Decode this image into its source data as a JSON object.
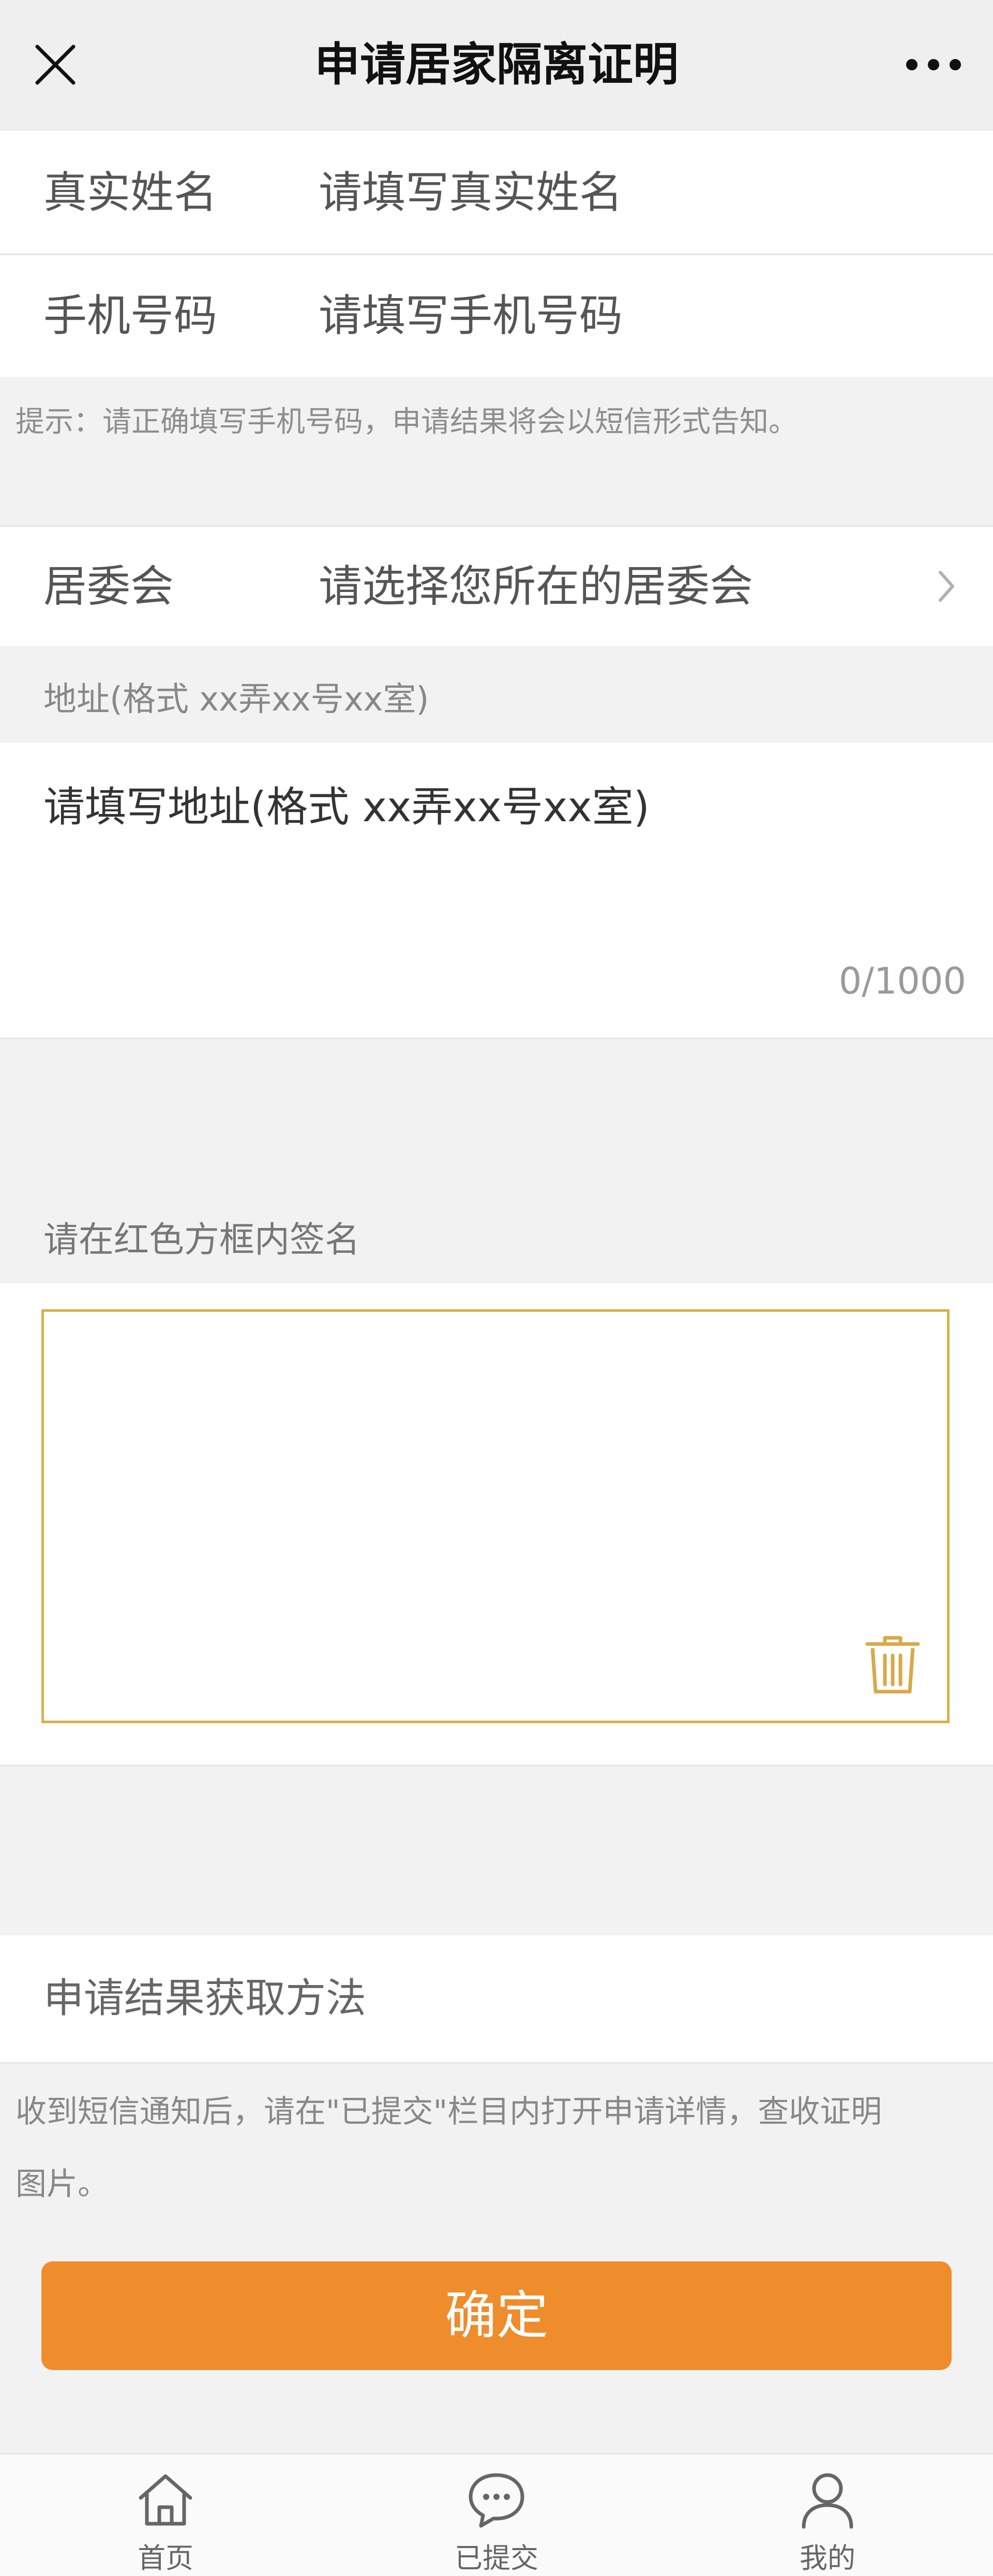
{
  "header": {
    "title": "申请居家隔离证明"
  },
  "form": {
    "name": {
      "label": "真实姓名",
      "placeholder": "请填写真实姓名"
    },
    "phone": {
      "label": "手机号码",
      "placeholder": "请填写手机号码"
    },
    "hint": "提示：请正确填写手机号码，申请结果将会以短信形式告知。",
    "committee": {
      "label": "居委会",
      "placeholder": "请选择您所在的居委会"
    },
    "address": {
      "label": "地址(格式 xx弄xx号xx室)",
      "placeholder": "请填写地址(格式  xx弄xx号xx室)",
      "counter": "0/1000"
    },
    "signature": {
      "label": "请在红色方框内签名"
    },
    "result_method": {
      "label": "申请结果获取方法",
      "description_line1": "收到短信通知后，请在\"已提交\"栏目内打开申请详情，查收证明",
      "description_line2": "图片。"
    },
    "confirm_label": "确定"
  },
  "tabbar": {
    "items": [
      {
        "label": "首页",
        "icon": "home-icon"
      },
      {
        "label": "已提交",
        "icon": "chat-bubble-icon"
      },
      {
        "label": "我的",
        "icon": "user-icon"
      }
    ]
  },
  "colors": {
    "accent": "#ef8c2c",
    "signature_border": "#d8b24a"
  }
}
